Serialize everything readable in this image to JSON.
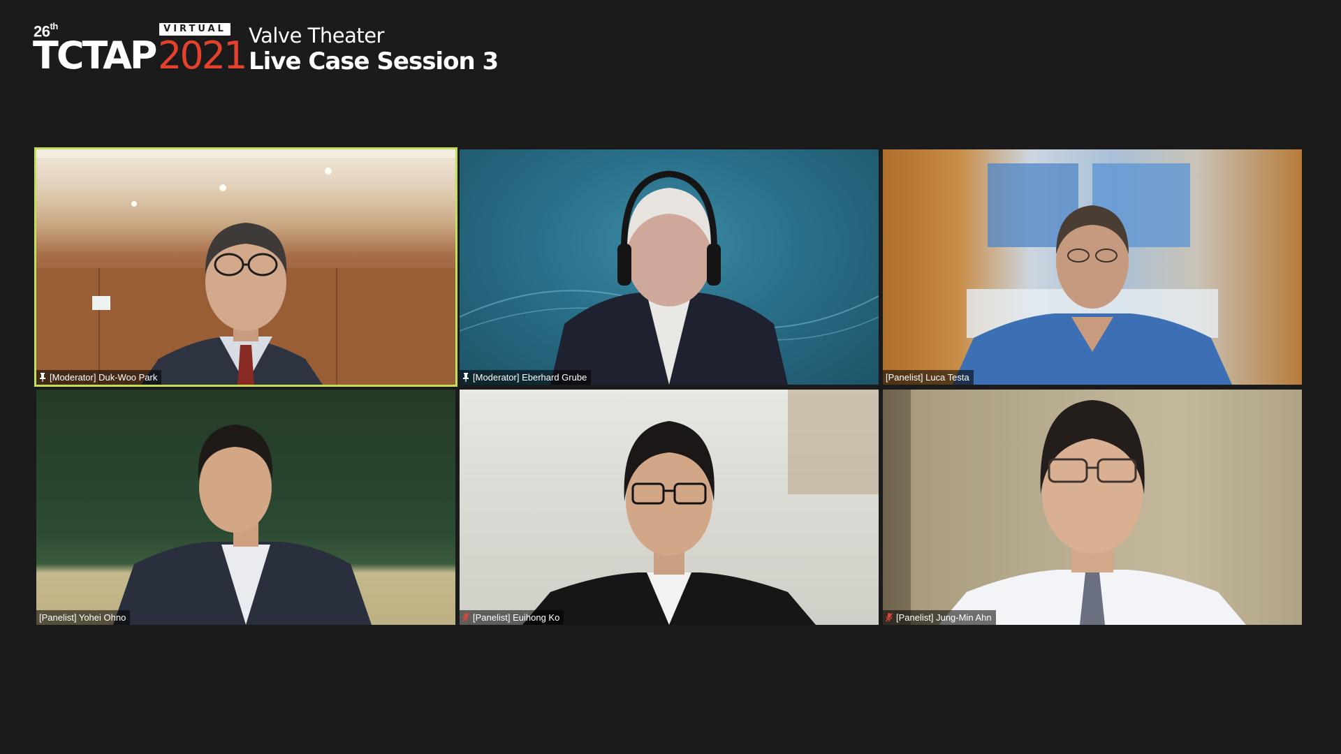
{
  "header": {
    "edition_number": "26",
    "edition_suffix": "th",
    "virtual_badge": "VIRTUAL",
    "event_name": "TCTAP",
    "event_year": "2021",
    "theater": "Valve Theater",
    "session_title": "Live Case Session 3"
  },
  "colors": {
    "background": "#1b1b1b",
    "year_red": "#e5422e",
    "active_speaker_border": "#c3e05b"
  },
  "participants": [
    {
      "label": "[Moderator] Duk-Woo Park",
      "icon": "pin-icon",
      "active_speaker": true
    },
    {
      "label": "[Moderator] Eberhard Grube",
      "icon": "pin-icon",
      "active_speaker": false
    },
    {
      "label": "[Panelist] Luca Testa",
      "icon": "",
      "active_speaker": false
    },
    {
      "label": "[Panelist] Yohei Ohno",
      "icon": "",
      "active_speaker": false
    },
    {
      "label": "[Panelist] Euihong Ko",
      "icon": "muted-mic-icon",
      "active_speaker": false
    },
    {
      "label": "[Panelist] Jung-Min Ahn",
      "icon": "muted-mic-icon",
      "active_speaker": false
    }
  ]
}
